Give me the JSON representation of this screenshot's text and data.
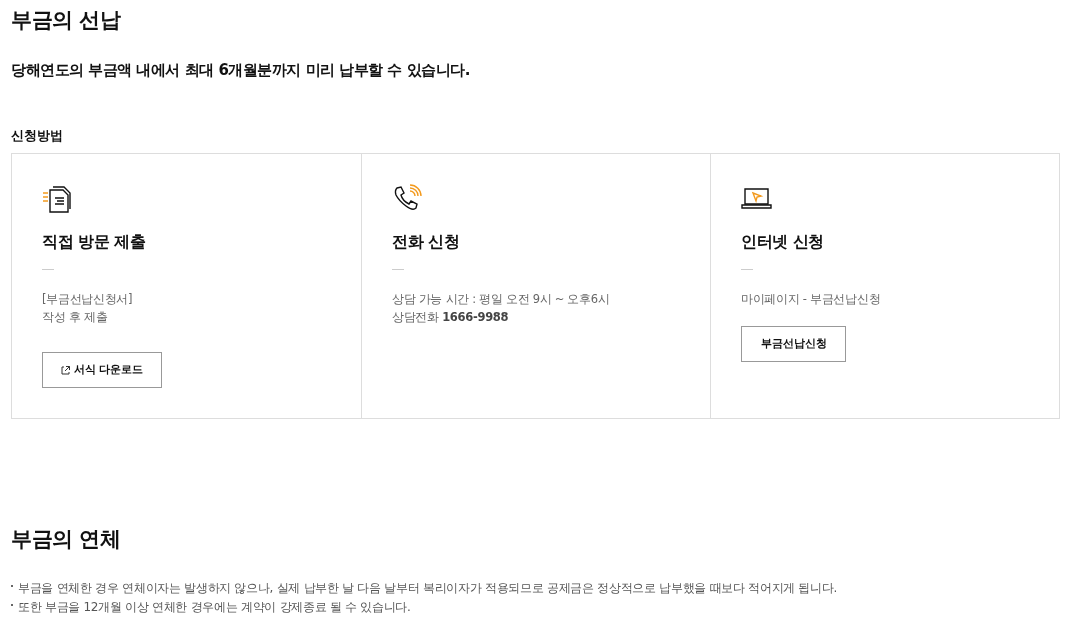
{
  "section_prepay": {
    "title": "부금의 선납",
    "subtitle": "당해연도의 부금액 내에서 최대 6개월분까지 미리 납부할 수 있습니다.",
    "methods_label": "신청방법",
    "methods": [
      {
        "kind": "document",
        "title": "직접 방문 제출",
        "lines": [
          "[부금선납신청서]",
          "작성 후 제출"
        ],
        "button": {
          "label": "서식 다운로드",
          "kind": "download"
        }
      },
      {
        "kind": "phone",
        "title": "전화 신청",
        "lines": [
          "상담 가능 시간 : 평일 오전 9시 ~ 오후6시",
          "상담전화 **1666-9988**"
        ]
      },
      {
        "kind": "laptop",
        "title": "인터넷 신청",
        "lines": [
          "마이페이지 - 부금선납신청"
        ],
        "button": {
          "label": "부금선납신청",
          "kind": "plain"
        }
      }
    ]
  },
  "section_overdue": {
    "title": "부금의 연체",
    "notes": [
      "부금을 연체한 경우 연체이자는 발생하지 않으나, 실제 납부한 날 다음 날부터 복리이자가 적용되므로 공제금은 정상적으로 납부했을 때보다 적어지게 됩니다.",
      "또한 부금을 12개월 이상 연체한 경우에는 계약이 강제종료 될 수 있습니다."
    ]
  }
}
